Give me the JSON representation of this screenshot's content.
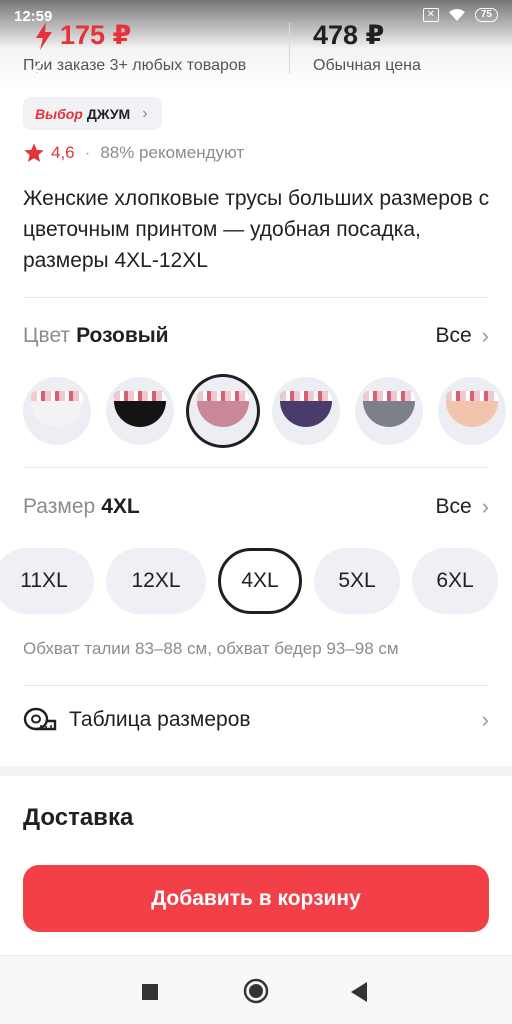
{
  "status_bar": {
    "time": "12:59",
    "battery": "75"
  },
  "price": {
    "promo_value": "175 ₽",
    "promo_note": "При заказе 3+ любых товаров",
    "regular_value": "478 ₽",
    "regular_note": "Обычная цена",
    "accent_color": "#e5333a"
  },
  "badge": {
    "brand": "Выбор",
    "name": "ДЖУМ"
  },
  "rating": {
    "score": "4,6",
    "separator": "·",
    "recommend": "88% рекомендуют"
  },
  "product": {
    "title": "Женские хлопковые трусы больших размеров с цветочным принтом — удобная посадка, размеры 4XL-12XL"
  },
  "color_section": {
    "label": "Цвет",
    "value": "Розовый",
    "all_label": "Все",
    "swatches": [
      {
        "color": "#f4f2f4",
        "selected": false
      },
      {
        "color": "#141414",
        "selected": false
      },
      {
        "color": "#c8879a",
        "selected": true
      },
      {
        "color": "#4a3c6a",
        "selected": false
      },
      {
        "color": "#7d8088",
        "selected": false
      },
      {
        "color": "#f2c4ae",
        "selected": false
      }
    ]
  },
  "size_section": {
    "label": "Размер",
    "value": "4XL",
    "all_label": "Все",
    "sizes": [
      {
        "label": "11XL",
        "selected": false
      },
      {
        "label": "12XL",
        "selected": false
      },
      {
        "label": "4XL",
        "selected": true
      },
      {
        "label": "5XL",
        "selected": false
      },
      {
        "label": "6XL",
        "selected": false
      }
    ],
    "measure": "Обхват талии 83–88 см, обхват бедер 93–98 см"
  },
  "size_table": {
    "label": "Таблица размеров"
  },
  "delivery": {
    "title": "Доставка"
  },
  "cart": {
    "button_label": "Добавить в корзину",
    "color": "#f23f48"
  }
}
